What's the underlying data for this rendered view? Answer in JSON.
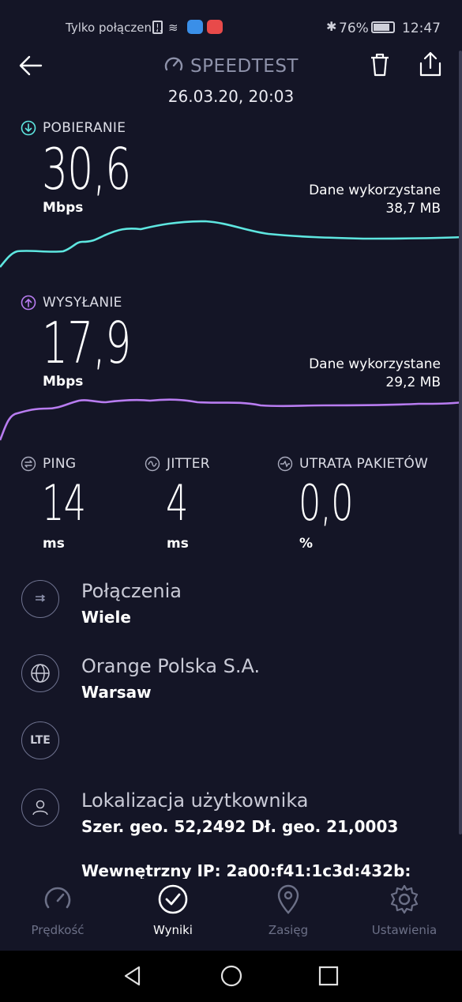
{
  "status_bar": {
    "notification": "Tylko połączen...",
    "battery": "76%",
    "time": "12:47"
  },
  "header": {
    "title": "SPEEDTEST",
    "date": "26.03.20, 20:03"
  },
  "download": {
    "label": "POBIERANIE",
    "value": "30,6",
    "unit": "Mbps",
    "data_used_label": "Dane wykorzystane",
    "data_used_value": "38,7 MB",
    "line_color": "#5ee6e0"
  },
  "upload": {
    "label": "WYSYŁANIE",
    "value": "17,9",
    "unit": "Mbps",
    "data_used_label": "Dane wykorzystane",
    "data_used_value": "29,2 MB",
    "line_color": "#b87cf0"
  },
  "metrics": {
    "ping": {
      "label": "PING",
      "value": "14",
      "unit": "ms"
    },
    "jitter": {
      "label": "JITTER",
      "value": "4",
      "unit": "ms"
    },
    "packet_loss": {
      "label": "UTRATA PAKIETÓW",
      "value": "0,0",
      "unit": "%"
    }
  },
  "info": {
    "connections": {
      "title": "Połączenia",
      "value": "Wiele",
      "icon": "connections-icon"
    },
    "provider": {
      "title": "Orange Polska S.A.",
      "value": "Warsaw",
      "icon": "globe-icon"
    },
    "network": {
      "icon_text": "LTE"
    },
    "location": {
      "title": "Lokalizacja użytkownika",
      "value": "Szer. geo. 52,2492 Dł. geo. 21,0003",
      "icon": "user-icon"
    },
    "internal_ip": "Wewnętrzny IP: 2a00:f41:1c3d:432b:"
  },
  "bottom_nav": [
    {
      "label": "Prędkość",
      "icon": "speedometer-icon",
      "active": false
    },
    {
      "label": "Wyniki",
      "icon": "check-circle-icon",
      "active": true
    },
    {
      "label": "Zasięg",
      "icon": "map-pin-icon",
      "active": false
    },
    {
      "label": "Ustawienia",
      "icon": "gear-icon",
      "active": false
    }
  ],
  "colors": {
    "background": "#141526",
    "accent_download": "#5ee6e0",
    "accent_upload": "#b87cf0",
    "inactive": "#6c7087"
  }
}
